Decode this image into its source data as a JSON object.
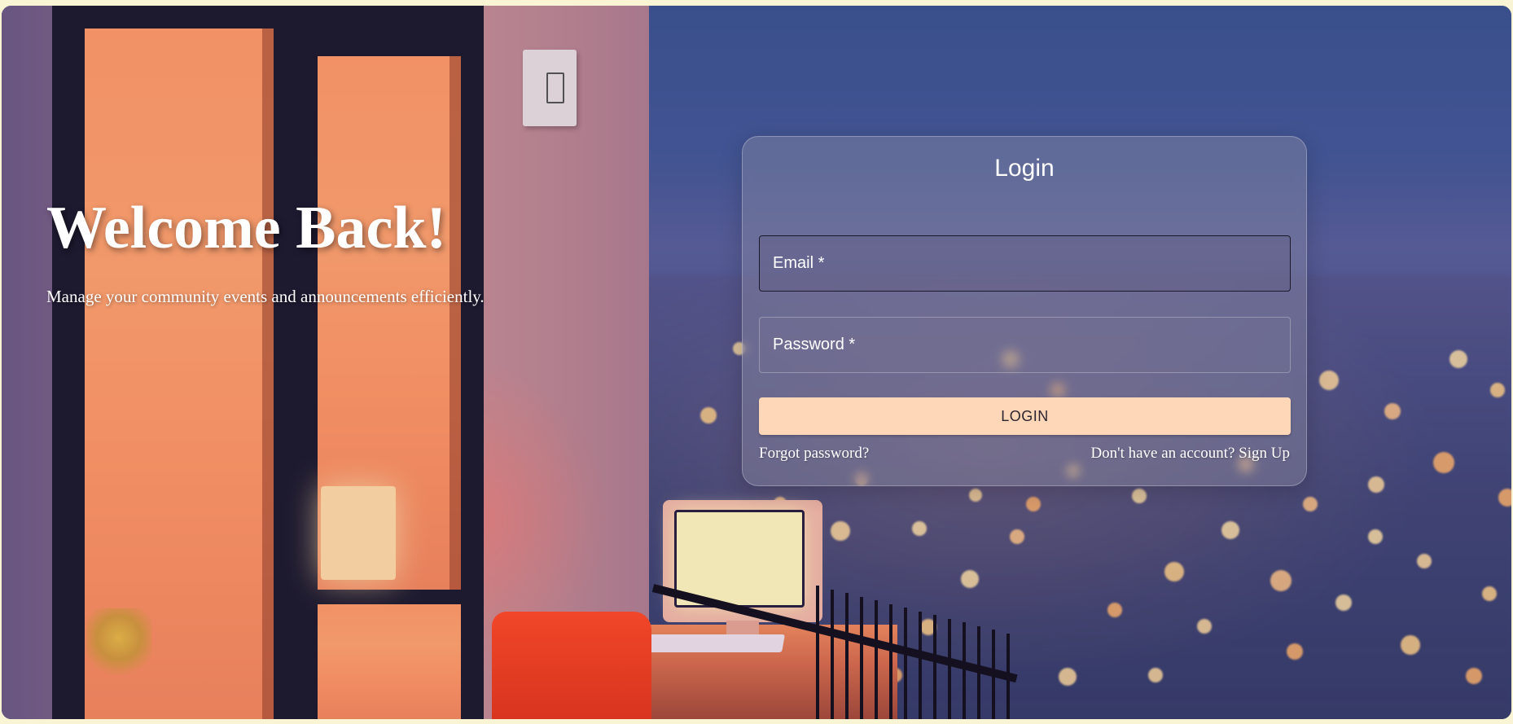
{
  "hero": {
    "title": "Welcome Back!",
    "subtitle": "Manage your community events and announcements efficiently."
  },
  "login": {
    "title": "Login",
    "email_placeholder": "Email *",
    "password_placeholder": "Password *",
    "submit_label": "LOGIN",
    "forgot_password": "Forgot password?",
    "signup_link": "Don't have an account? Sign Up"
  },
  "colors": {
    "button": "#fdd7b8",
    "page_background": "#f8f4d4",
    "text": "#ffffff"
  }
}
